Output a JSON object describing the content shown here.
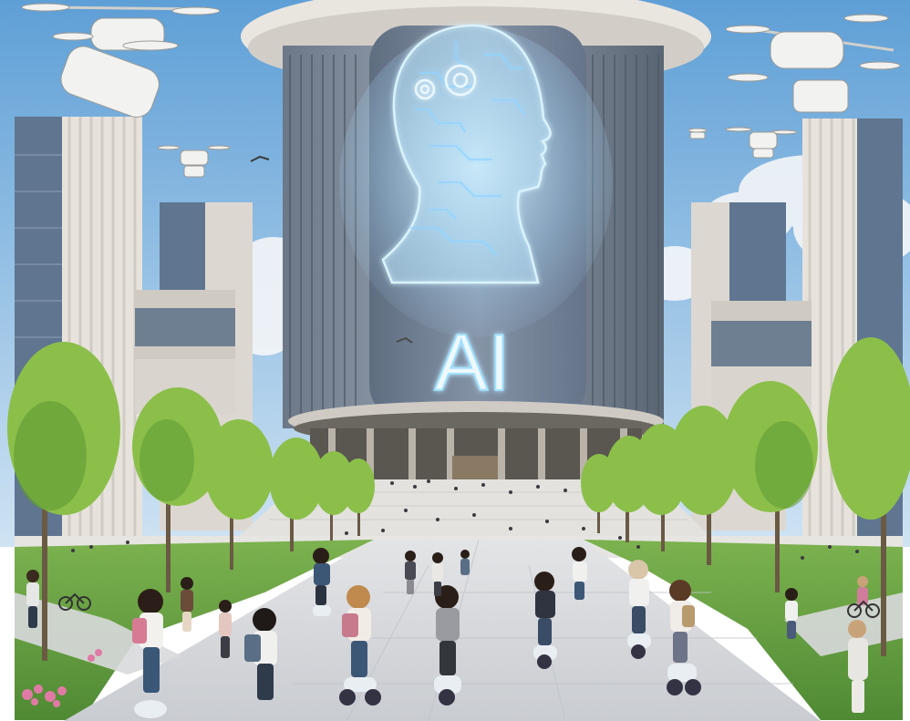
{
  "scene": {
    "tower_sign": "AI",
    "colors": {
      "sky_top": "#5e9fd6",
      "sky_bottom": "#cfe3f3",
      "cloud": "#f4f6f8",
      "building_light": "#e7e3dc",
      "building_shadow": "#b9b6b1",
      "glass": "#5f7590",
      "tower_body": "#7f8c9c",
      "tower_dark": "#5c6776",
      "roof_disc": "#e9e5df",
      "hologram_glow": "#bfe8ff",
      "hologram_line": "#8fd4ff",
      "grass": "#6fa647",
      "grass_dark": "#4f8a34",
      "tree": "#8bbf4a",
      "tree_dark": "#5f9a33",
      "path": "#d6d8db",
      "plaza": "#e3e2df",
      "drone_body": "#f2f2f0",
      "scooter": "#e9eef3"
    },
    "icons": [
      "drone-icon",
      "hologram-head-icon",
      "tree-icon",
      "person-icon",
      "scooter-icon"
    ]
  }
}
